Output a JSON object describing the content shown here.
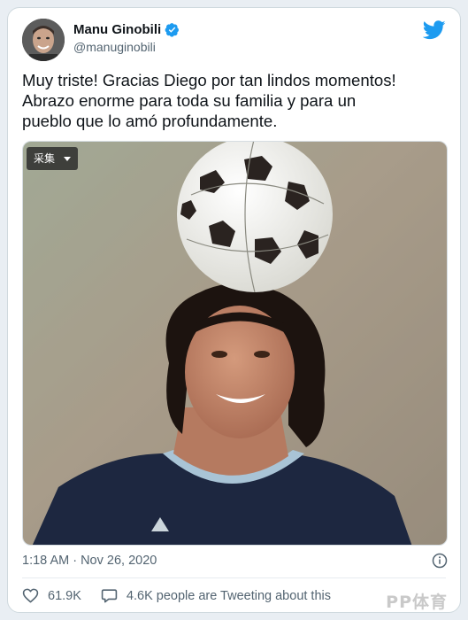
{
  "tweet": {
    "author": {
      "display_name": "Manu Ginobili",
      "handle": "@manuginobili",
      "verified": true
    },
    "text": "Muy triste! Gracias Diego por tan lindos momentos!\nAbrazo enorme para toda su familia y para un\npueblo que lo amó profundamente.",
    "media": {
      "collect_label": "采集",
      "description_icon": "photo"
    },
    "timestamp": "1:18 AM · Nov 26, 2020",
    "likes": "61.9K",
    "discussion": "4.6K people are Tweeting about this"
  },
  "watermark": "PP体育",
  "colors": {
    "brand_blue": "#1d9bf0",
    "text_primary": "#0f1419",
    "text_secondary": "#536471",
    "border": "#cfd9de"
  },
  "icons": [
    "verified-badge-icon",
    "twitter-bird-icon",
    "info-icon",
    "heart-icon",
    "comment-icon",
    "dropdown-caret-icon"
  ]
}
